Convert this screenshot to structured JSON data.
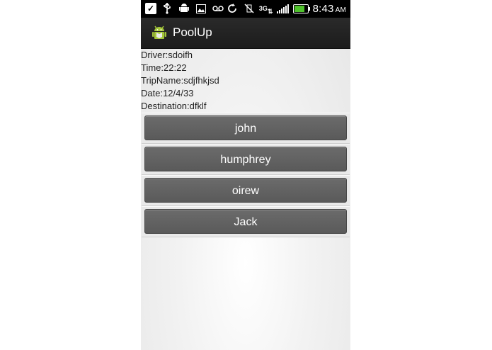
{
  "status_bar": {
    "time": "8:43",
    "ampm": "AM",
    "network": "3G"
  },
  "app": {
    "title": "PoolUp"
  },
  "trip": {
    "driver": "Driver:sdoifh",
    "time": "Time:22:22",
    "trip_name": "TripName:sdjfhkjsd",
    "date": "Date:12/4/33",
    "destination": "Destination:dfklf"
  },
  "passengers": [
    {
      "label": "john"
    },
    {
      "label": "humphrey"
    },
    {
      "label": "oirew"
    },
    {
      "label": "Jack"
    }
  ],
  "colors": {
    "status_bar": "#000000",
    "action_bar": "#222222",
    "button": "#616161",
    "battery": "#4fc22b"
  }
}
